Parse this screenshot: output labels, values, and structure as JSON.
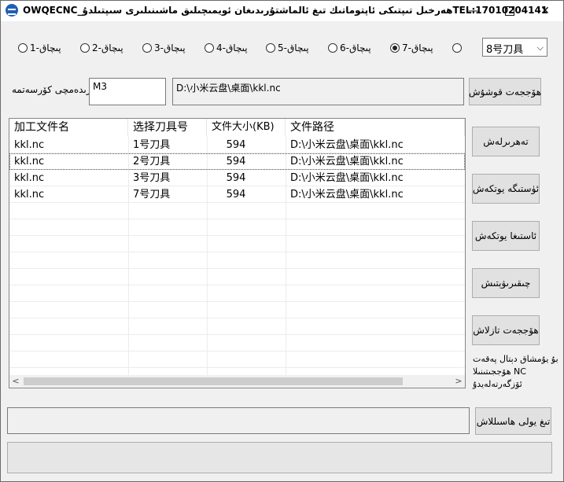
{
  "window": {
    "title": "OWQECNC_ھەرخىل تىپتىكى ئاپتوماتىك تىغ ئالماشتۇرىدىغان ئويمىچىلىق ماشىنىلىرى سىپتىلدۇTEL:17010204141",
    "minimize_glyph": "—",
    "close_glyph": "✕"
  },
  "radios": [
    {
      "label": "پىچاق-1",
      "selected": false
    },
    {
      "label": "پىچاق-2",
      "selected": false
    },
    {
      "label": "پىچاق-3",
      "selected": false
    },
    {
      "label": "پىچاق-4",
      "selected": false
    },
    {
      "label": "پىچاق-5",
      "selected": false
    },
    {
      "label": "پىچاق-6",
      "selected": false
    },
    {
      "label": "پىچاق-7",
      "selected": true
    },
    {
      "label": "",
      "selected": false
    }
  ],
  "tool_select": {
    "value": "8号刀具"
  },
  "param": {
    "label": "يارىدەمچى كۆرسەتمە",
    "input_value": "M3",
    "path_value": "D:\\小米云盘\\桌面\\kkl.nc",
    "add_button": "ھۆججەت قوشۇش"
  },
  "table": {
    "headers": [
      "加工文件名",
      "选择刀具号",
      "文件大小(KB)",
      "文件路径"
    ],
    "rows": [
      [
        "kkl.nc",
        "1号刀具",
        "594",
        "D:\\小米云盘\\桌面\\kkl.nc"
      ],
      [
        "kkl.nc",
        "2号刀具",
        "594",
        "D:\\小米云盘\\桌面\\kkl.nc"
      ],
      [
        "kkl.nc",
        "3号刀具",
        "594",
        "D:\\小米云盘\\桌面\\kkl.nc"
      ],
      [
        "kkl.nc",
        "7号刀具",
        "594",
        "D:\\小米云盘\\桌面\\kkl.nc"
      ]
    ],
    "scroll_left": "<",
    "scroll_right": ">"
  },
  "side_buttons": {
    "edit": "تەھرىرلەش",
    "move_up": "ئۈستىگە يوتكەش",
    "move_down": "ئاستىغا يوتكەش",
    "delete": "چىقىرىۋېتىش",
    "clear": "ھۆججەت تازلاش"
  },
  "side_note": "بۇ يۇمشاق دېتال پەقەت NC ھۆججىتىنىلا ئۆزگەرتەلەيدۇ",
  "output": {
    "path_value": "",
    "generate_button": "تىغ يولى ھاسىللاش"
  },
  "status_text": ""
}
